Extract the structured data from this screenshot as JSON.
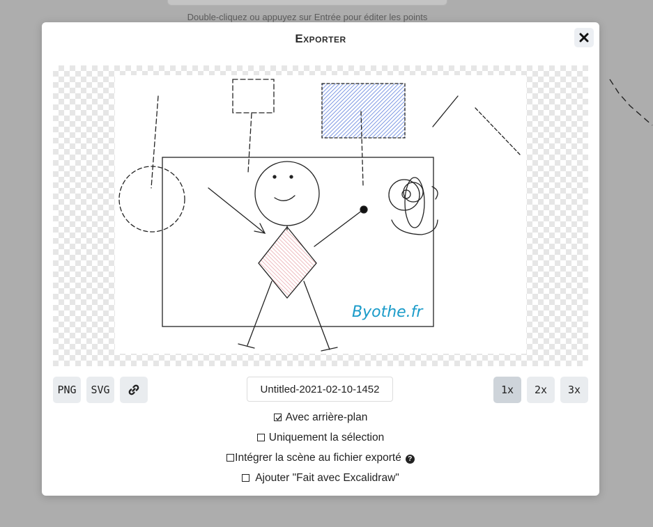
{
  "background": {
    "hint": "Double-cliquez ou appuyez sur Entrée pour éditer les points"
  },
  "dialog": {
    "title": "Exporter",
    "close_icon": "close-x-icon"
  },
  "drawing": {
    "watermark": "Byothe.fr",
    "shapes": [
      "dashed-circle",
      "dashed-square",
      "blue-hatched-rectangle",
      "frame-rectangle",
      "stick-figure",
      "pink-diamond",
      "arrow",
      "spiral-scribble",
      "dashed-lines"
    ],
    "colors": {
      "blue_fill": "#5b7ddb",
      "pink_fill": "#e8a0a4",
      "watermark": "#1a9bc9"
    }
  },
  "export_buttons": {
    "png": "PNG",
    "svg": "SVG",
    "link_icon": "link-icon"
  },
  "filename": "Untitled-2021-02-10-1452",
  "scale_buttons": [
    {
      "label": "1x",
      "selected": true
    },
    {
      "label": "2x",
      "selected": false
    },
    {
      "label": "3x",
      "selected": false
    }
  ],
  "options": [
    {
      "label": "Avec arrière-plan",
      "checked": true
    },
    {
      "label": "Uniquement la sélection",
      "checked": false
    },
    {
      "label": "Intégrer la scène au fichier exporté",
      "checked": false,
      "help": "?"
    },
    {
      "label": "Ajouter \"Fait avec Excalidraw\"",
      "checked": false
    }
  ]
}
